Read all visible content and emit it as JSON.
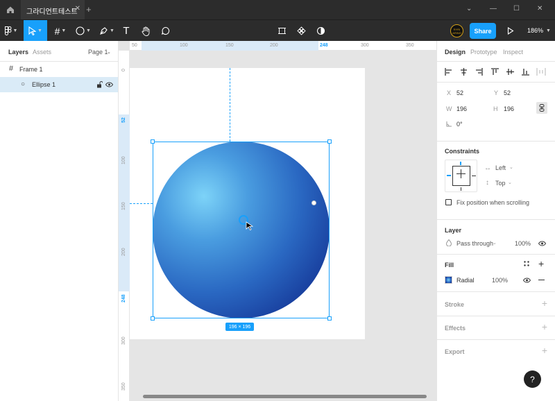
{
  "tabbar": {
    "file_tab": "그라디언트테스트",
    "close": "✕",
    "new_tab": "+",
    "window_controls": [
      "⌄",
      "—",
      "☐",
      "✕"
    ]
  },
  "toolbar": {
    "tools": [
      "main-menu",
      "move",
      "frame",
      "shape",
      "pen",
      "text",
      "hand",
      "comment"
    ],
    "text_tool": "T",
    "avatar_text": "RYRI ARINO",
    "share_label": "Share",
    "zoom": "186%"
  },
  "left_panel": {
    "tab_layers": "Layers",
    "tab_assets": "Assets",
    "page_selector": "Page 1",
    "layers": [
      {
        "name": "Frame 1",
        "icon": "#"
      },
      {
        "name": "Ellipse 1",
        "icon": "○"
      }
    ]
  },
  "canvas": {
    "h_ruler": [
      "50",
      "100",
      "150",
      "200",
      "248",
      "300",
      "350"
    ],
    "v_ruler": [
      "0",
      "52",
      "100",
      "150",
      "200",
      "248",
      "300",
      "350"
    ],
    "size_badge": "196 × 196"
  },
  "right_panel": {
    "tabs": [
      "Design",
      "Prototype",
      "Inspect"
    ],
    "transform": {
      "x_label": "X",
      "x": "52",
      "y_label": "Y",
      "y": "52",
      "w_label": "W",
      "w": "196",
      "h_label": "H",
      "h": "196",
      "rotation": "0°"
    },
    "constraints": {
      "title": "Constraints",
      "horizontal": "Left",
      "vertical": "Top",
      "fix_scroll": "Fix position when scrolling"
    },
    "layer": {
      "title": "Layer",
      "blend": "Pass through",
      "opacity": "100%"
    },
    "fill": {
      "title": "Fill",
      "type": "Radial",
      "opacity": "100%"
    },
    "stroke_title": "Stroke",
    "effects_title": "Effects",
    "export_title": "Export"
  },
  "help_label": "?",
  "colors": {
    "accent": "#18a0fb",
    "toolbar_bg": "#2c2c2c",
    "gradient_center": "#7dd3f8",
    "gradient_edge": "#0b1f82"
  }
}
